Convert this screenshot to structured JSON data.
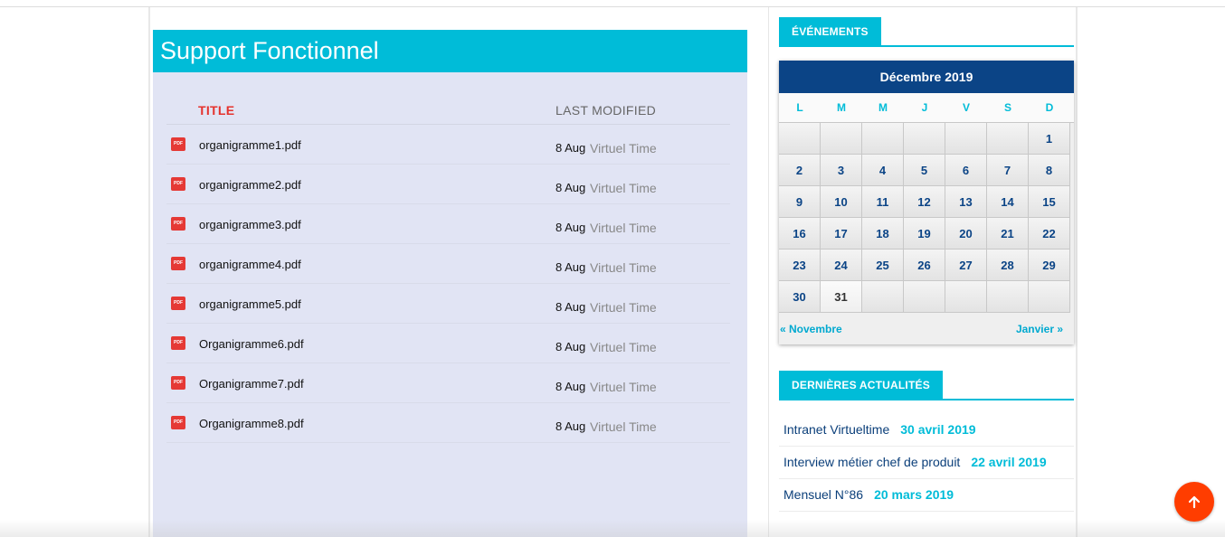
{
  "main": {
    "title": "Support Fonctionnel",
    "columns": {
      "title": "TITLE",
      "modified": "LAST MODIFIED"
    },
    "documents": [
      {
        "icon": "pdf-icon",
        "name": "organigramme1.pdf",
        "date": "8 Aug",
        "author": "Virtuel Time"
      },
      {
        "icon": "pdf-icon",
        "name": "organigramme2.pdf",
        "date": "8 Aug",
        "author": "Virtuel Time"
      },
      {
        "icon": "pdf-icon",
        "name": "organigramme3.pdf",
        "date": "8 Aug",
        "author": "Virtuel Time"
      },
      {
        "icon": "pdf-icon",
        "name": "organigramme4.pdf",
        "date": "8 Aug",
        "author": "Virtuel Time"
      },
      {
        "icon": "pdf-icon",
        "name": "organigramme5.pdf",
        "date": "8 Aug",
        "author": "Virtuel Time"
      },
      {
        "icon": "pdf-icon",
        "name": "Organigramme6.pdf",
        "date": "8 Aug",
        "author": "Virtuel Time"
      },
      {
        "icon": "pdf-icon",
        "name": "Organigramme7.pdf",
        "date": "8 Aug",
        "author": "Virtuel Time"
      },
      {
        "icon": "pdf-icon",
        "name": "Organigramme8.pdf",
        "date": "8 Aug",
        "author": "Virtuel Time"
      }
    ]
  },
  "sidebar": {
    "events_title": "ÉVÉNEMENTS",
    "calendar": {
      "month": "Décembre 2019",
      "weekdays": [
        "L",
        "M",
        "M",
        "J",
        "V",
        "S",
        "D"
      ],
      "days": [
        "",
        "",
        "",
        "",
        "",
        "",
        "1",
        "2",
        "3",
        "4",
        "5",
        "6",
        "7",
        "8",
        "9",
        "10",
        "11",
        "12",
        "13",
        "14",
        "15",
        "16",
        "17",
        "18",
        "19",
        "20",
        "21",
        "22",
        "23",
        "24",
        "25",
        "26",
        "27",
        "28",
        "29",
        "30",
        "31",
        "",
        "",
        "",
        "",
        ""
      ],
      "today": "31",
      "prev": "« Novembre",
      "next": "Janvier »"
    },
    "news_title": "DERNIÈRES ACTUALITÉS",
    "news": [
      {
        "title": "Intranet Virtueltime",
        "date": "30 avril 2019"
      },
      {
        "title": "Interview métier chef de produit",
        "date": "22 avril 2019"
      },
      {
        "title": "Mensuel N°86",
        "date": "20 mars 2019"
      }
    ]
  },
  "scroll_top_icon": "arrow-up-icon",
  "colors": {
    "accent": "#00bcd8",
    "calendar_header": "#0b4486",
    "scroll_button": "#ff3d00",
    "title_column": "#e5322d"
  }
}
